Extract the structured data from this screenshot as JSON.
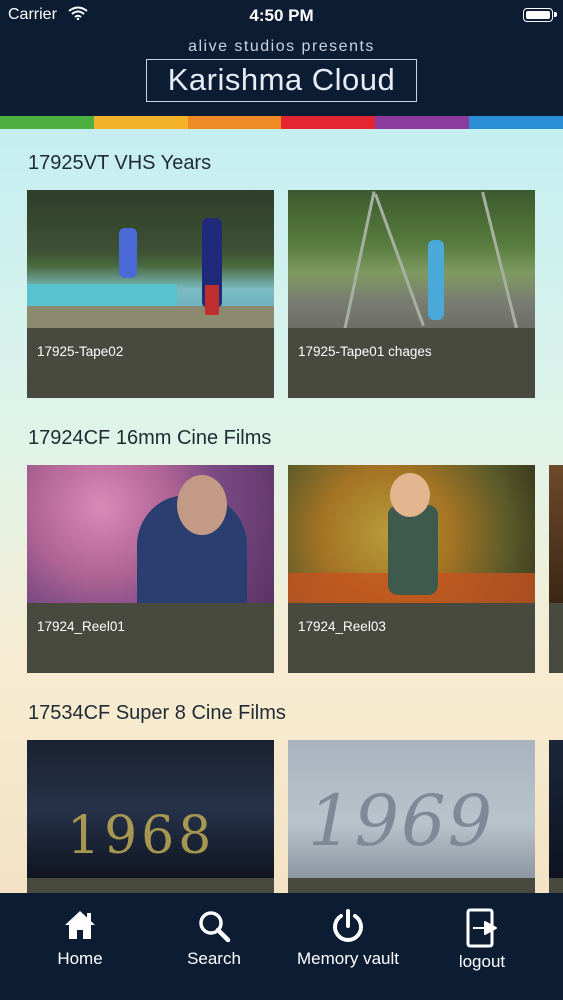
{
  "status_bar": {
    "carrier": "Carrier",
    "time": "4:50 PM"
  },
  "header": {
    "presents": "alive studios presents",
    "brand": "Karishma Cloud"
  },
  "colors": {
    "rainbow": [
      "#4caf3e",
      "#f4b12a",
      "#f08a25",
      "#e3262f",
      "#8a3b9c",
      "#2a8fd6"
    ],
    "nav_bg": "#0c1c33",
    "card_caption_bg": "#48493f"
  },
  "sections": [
    {
      "title": "17925VT VHS Years",
      "cards": [
        {
          "caption": "17925-Tape02"
        },
        {
          "caption": "17925-Tape01 chages"
        }
      ]
    },
    {
      "title": "17924CF 16mm Cine Films",
      "cards": [
        {
          "caption": "17924_Reel01"
        },
        {
          "caption": "17924_Reel03"
        }
      ]
    },
    {
      "title": "17534CF Super 8 Cine Films",
      "cards": [
        {
          "caption": ""
        },
        {
          "caption": ""
        }
      ]
    }
  ],
  "tabbar": [
    {
      "label": "Home",
      "icon": "home-icon"
    },
    {
      "label": "Search",
      "icon": "search-icon"
    },
    {
      "label": "Memory vault",
      "icon": "power-icon"
    },
    {
      "label": "logout",
      "icon": "logout-icon"
    }
  ]
}
